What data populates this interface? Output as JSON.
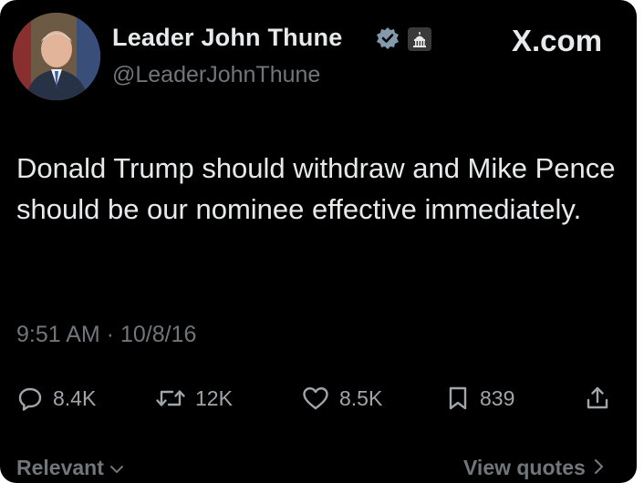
{
  "site": "X.com",
  "author": {
    "name": "Leader John Thune",
    "handle": "@LeaderJohnThune",
    "verified_icon": "verified-badge-icon",
    "affiliation_icon": "capitol-building-icon"
  },
  "tweet": {
    "text": "Donald Trump should withdraw and Mike Pence should be our nominee effective immediately.",
    "timestamp": "9:51 AM · 10/8/16"
  },
  "actions": {
    "replies": "8.4K",
    "reposts": "12K",
    "likes": "8.5K",
    "bookmarks": "839"
  },
  "footer": {
    "sort_label": "Relevant",
    "view_quotes_label": "View quotes"
  },
  "colors": {
    "background": "#000000",
    "primary_text": "#e7e9ea",
    "secondary_text": "#71767b",
    "verified_badge": "#829aab"
  }
}
